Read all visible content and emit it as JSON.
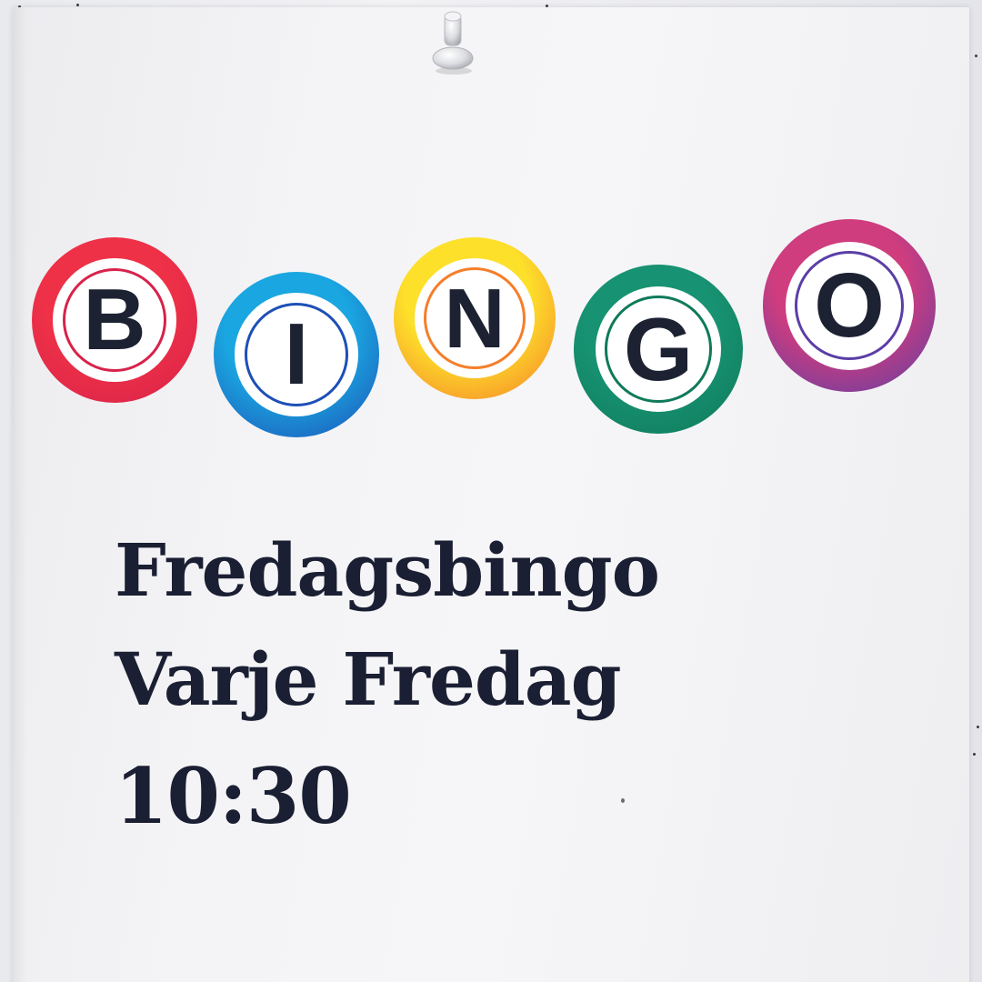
{
  "poster": {
    "balls": [
      {
        "letter": "B",
        "color_top": "#ee3147",
        "color_bottom": "#d8224a"
      },
      {
        "letter": "I",
        "color_top": "#1aa6e0",
        "color_bottom": "#1e4fb6"
      },
      {
        "letter": "N",
        "color_top": "#fde02a",
        "color_bottom": "#f57e2a"
      },
      {
        "letter": "G",
        "color_top": "#179272",
        "color_bottom": "#0f7a5a"
      },
      {
        "letter": "O",
        "color_top": "#cf3d7e",
        "color_bottom": "#5b3ea6"
      }
    ],
    "line1": "Fredagsbingo",
    "line2": "Varje Fredag",
    "line3": "10:30"
  }
}
